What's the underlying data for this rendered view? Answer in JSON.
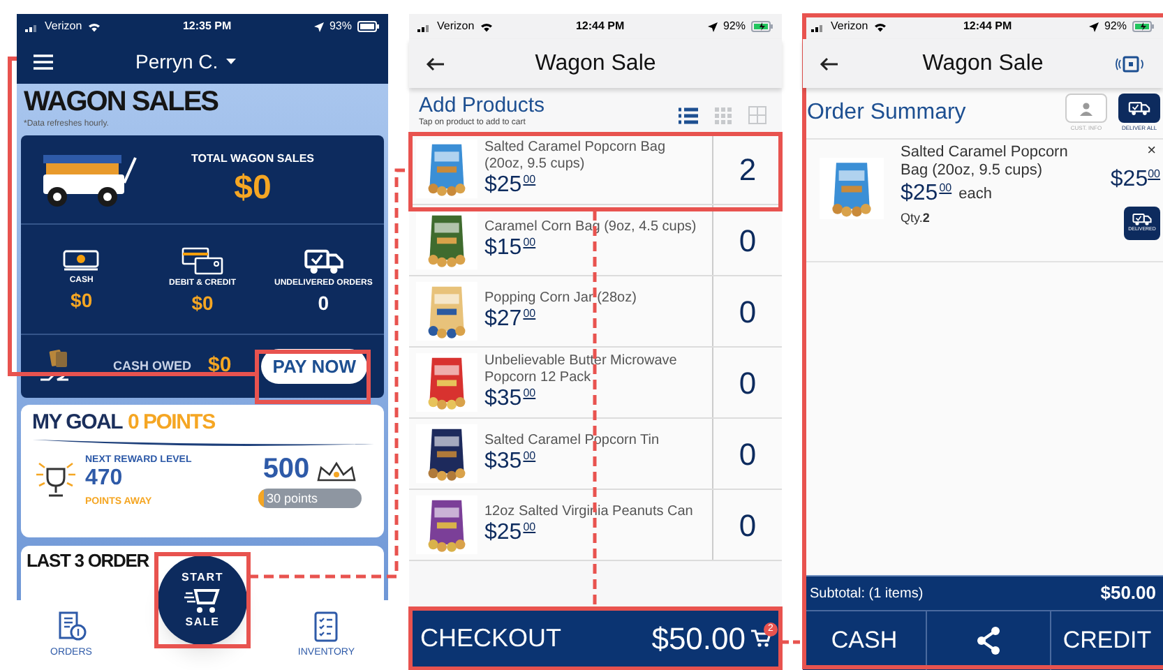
{
  "dashboard": {
    "status_bar": {
      "carrier": "Verizon",
      "time": "12:35 PM",
      "battery": "93%",
      "charging": false
    },
    "user_menu": "Perryn C.",
    "title": "WAGON SALES",
    "note": "*Data refreshes hourly.",
    "total": {
      "label": "TOTAL WAGON SALES",
      "value": "$0"
    },
    "stats": [
      {
        "kind": "cash",
        "label": "CASH",
        "value": "$0"
      },
      {
        "kind": "card",
        "label": "DEBIT & CREDIT",
        "value": "$0"
      },
      {
        "kind": "orders",
        "label": "UNDELIVERED ORDERS",
        "value": "0"
      }
    ],
    "cash_owed": {
      "label": "CASH OWED",
      "value": "$0",
      "button": "PAY NOW"
    },
    "goal": {
      "title": "MY GOAL",
      "points": "0 POINTS",
      "next_label": "NEXT REWARD LEVEL",
      "points_away": "470",
      "points_away_label": "POINTS AWAY",
      "target": "500",
      "progress_text": "30 points",
      "level": 0.06
    },
    "last_orders_title": "LAST 3 ORDER",
    "start_button": [
      "START",
      "SALE"
    ],
    "nav": [
      {
        "kind": "orders",
        "label": "ORDERS"
      },
      {
        "kind": "inventory",
        "label": "INVENTORY"
      }
    ]
  },
  "add_products": {
    "status_bar": {
      "carrier": "Verizon",
      "time": "12:44 PM",
      "battery": "92%",
      "charging": true
    },
    "title": "Wagon Sale",
    "heading": "Add Products",
    "hint": "Tap on product to add to cart",
    "view_options": [
      {
        "kind": "list",
        "selected": true
      },
      {
        "kind": "grid",
        "selected": false
      },
      {
        "kind": "tiles",
        "selected": false
      }
    ],
    "products": [
      {
        "name": "Salted Caramel Popcorn Bag (20oz, 9.5 cups)",
        "price": "$25",
        "cents": "00",
        "qty": "2"
      },
      {
        "name": "Caramel Corn Bag (9oz, 4.5 cups)",
        "price": "$15",
        "cents": "00",
        "qty": "0"
      },
      {
        "name": "Popping Corn Jar (28oz)",
        "price": "$27",
        "cents": "00",
        "qty": "0"
      },
      {
        "name": "Unbelievable Butter Microwave Popcorn 12 Pack",
        "price": "$35",
        "cents": "00",
        "qty": "0"
      },
      {
        "name": "Salted Caramel Popcorn Tin",
        "price": "$35",
        "cents": "00",
        "qty": "0"
      },
      {
        "name": "12oz Salted Virginia Peanuts Can",
        "price": "$25",
        "cents": "00",
        "qty": "0"
      }
    ],
    "checkout": {
      "label": "CHECKOUT",
      "total": "$50.00",
      "badge": "2"
    }
  },
  "order_summary": {
    "status_bar": {
      "carrier": "Verizon",
      "time": "12:44 PM",
      "battery": "92%",
      "charging": true
    },
    "title": "Wagon Sale",
    "heading": "Order Summary",
    "actions": [
      {
        "kind": "customer",
        "label": "CUST. INFO"
      },
      {
        "kind": "deliver",
        "label": "DELIVER ALL"
      }
    ],
    "items": [
      {
        "name": "Salted Caramel Popcorn Bag (20oz, 9.5 cups)",
        "price": "$25",
        "cents": "00",
        "each": "each",
        "qty_label": "Qty.",
        "qty": "2",
        "total": "$25",
        "total_cents": "00",
        "remove": "×",
        "delivered_label": "DELIVERED"
      }
    ],
    "subtotal_label": "Subtotal: (1 items)",
    "subtotal": "$50.00",
    "payment_buttons": [
      {
        "kind": "text",
        "label": "CASH"
      },
      {
        "kind": "share"
      },
      {
        "kind": "text",
        "label": "CREDIT"
      }
    ]
  }
}
